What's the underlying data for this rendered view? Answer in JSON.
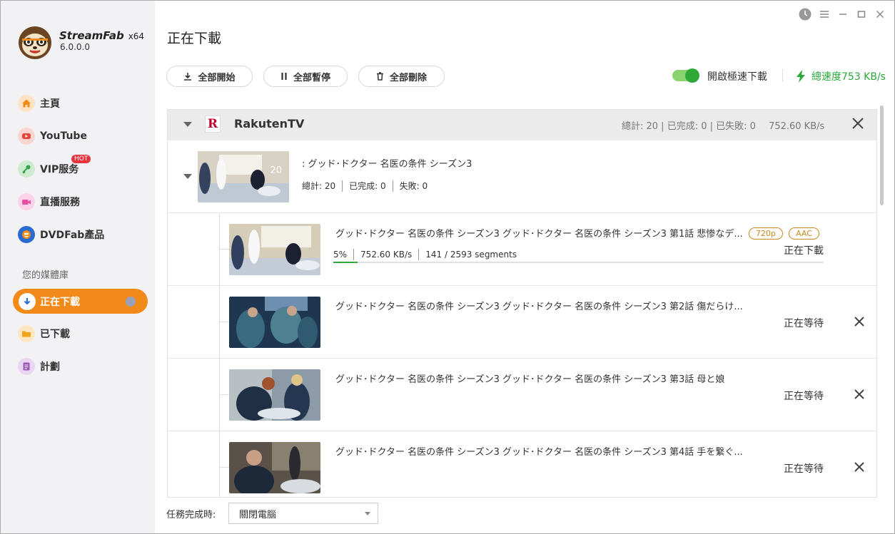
{
  "app": {
    "brand": "StreamFab",
    "arch": "x64",
    "version": "6.0.0.0"
  },
  "sidebar": {
    "items": [
      {
        "label": "主頁",
        "icon": "home-icon",
        "color": "#f28a1a"
      },
      {
        "label": "YouTube",
        "icon": "youtube-icon",
        "color": "#e8453c"
      },
      {
        "label": "VIP服务",
        "icon": "key-icon",
        "color": "#3aa34a",
        "badge": "HOT"
      },
      {
        "label": "直播服務",
        "icon": "camera-icon",
        "color": "#e84fa3"
      },
      {
        "label": "DVDFab產品",
        "icon": "dvdfab-icon",
        "color": "#2a6bd1"
      }
    ],
    "library_title": "您的媒體庫",
    "library": [
      {
        "label": "正在下載",
        "icon": "download-icon",
        "active": true
      },
      {
        "label": "已下載",
        "icon": "folder-icon",
        "color": "#f2a51a"
      },
      {
        "label": "計劃",
        "icon": "list-icon",
        "color": "#9b59b6"
      }
    ]
  },
  "header": {
    "title": "正在下載",
    "start_all": "全部開始",
    "pause_all": "全部暫停",
    "delete_all": "全部刪除",
    "turbo_label": "開啟極速下載",
    "turbo_on": true,
    "total_speed": "總速度753 KB/s"
  },
  "group": {
    "name": "RakutenTV",
    "logo_letter": "R",
    "stats": "總計: 20 | 已完成: 0 | 已失敗: 0",
    "speed": "752.60 KB/s",
    "season": {
      "title": ": グッド･ドクター 名医の条件 シーズン3",
      "thumb_count": "20",
      "total": "總計: 20",
      "done": "已完成: 0",
      "failed": "失敗: 0"
    },
    "items": [
      {
        "title": "グッド･ドクター 名医の条件 シーズン3 グッド･ドクター 名医の条件 シーズン3 第1話 悲惨なデ...",
        "badges": [
          "720p",
          "AAC"
        ],
        "percent": "5%",
        "progress": 0.05,
        "speed": "752.60 KB/s",
        "segments": "141 / 2593 segments",
        "status": "正在下載"
      },
      {
        "title": "グッド･ドクター 名医の条件 シーズン3 グッド･ドクター 名医の条件 シーズン3 第2話 傷だらけ...",
        "status": "正在等待"
      },
      {
        "title": "グッド･ドクター 名医の条件 シーズン3 グッド･ドクター 名医の条件 シーズン3 第3話 母と娘",
        "status": "正在等待"
      },
      {
        "title": "グッド･ドクター 名医の条件 シーズン3 グッド･ドクター 名医の条件 シーズン3 第4話 手を繋ぐ...",
        "status": "正在等待"
      }
    ]
  },
  "footer": {
    "label": "任務完成時:",
    "selected": "關閉電腦"
  }
}
